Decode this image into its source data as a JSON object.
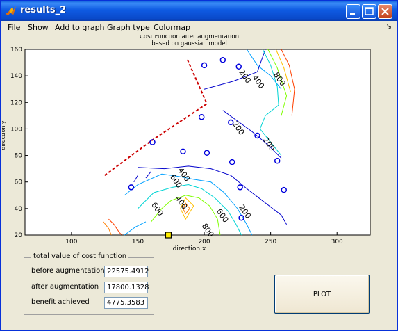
{
  "window": {
    "title": "results_2"
  },
  "menu": [
    "File",
    "Show",
    "Add to graph",
    "Graph type",
    "Colormap"
  ],
  "chart_data": {
    "type": "contour",
    "title_lines": [
      "Cost Function after augmentation",
      "based on gaussian model"
    ],
    "xlabel": "direction x",
    "ylabel": "direction y",
    "xlim": [
      65,
      325
    ],
    "ylim": [
      20,
      160
    ],
    "xticks": [
      100,
      150,
      200,
      250,
      300
    ],
    "yticks": [
      20,
      40,
      60,
      80,
      100,
      120,
      140,
      160
    ],
    "points": [
      [
        200,
        148
      ],
      [
        214,
        152
      ],
      [
        226,
        147
      ],
      [
        198,
        109
      ],
      [
        220,
        105
      ],
      [
        240,
        95
      ],
      [
        184,
        83
      ],
      [
        202,
        82
      ],
      [
        161,
        90
      ],
      [
        221,
        75
      ],
      [
        255,
        76
      ],
      [
        145,
        56
      ],
      [
        227,
        56
      ],
      [
        260,
        54
      ],
      [
        228,
        33
      ]
    ],
    "highlight_point": [
      173,
      20
    ],
    "boundary_line": [
      [
        125,
        65
      ],
      [
        160,
        91
      ],
      [
        202,
        119
      ],
      [
        187,
        153
      ]
    ],
    "contour_labels": [
      {
        "text": "200",
        "x": 226,
        "y": 143
      },
      {
        "text": "200",
        "x": 244,
        "y": 92
      },
      {
        "text": "200",
        "x": 221,
        "y": 104
      },
      {
        "text": "200",
        "x": 226,
        "y": 41
      },
      {
        "text": "400",
        "x": 236,
        "y": 139
      },
      {
        "text": "400",
        "x": 180,
        "y": 69
      },
      {
        "text": "400",
        "x": 178,
        "y": 48
      },
      {
        "text": "600",
        "x": 174,
        "y": 64
      },
      {
        "text": "600",
        "x": 209,
        "y": 38
      },
      {
        "text": "600",
        "x": 160,
        "y": 43
      },
      {
        "text": "800",
        "x": 252,
        "y": 141
      },
      {
        "text": "800",
        "x": 198,
        "y": 27
      }
    ]
  },
  "results": {
    "group_title": "total value of cost function",
    "rows": [
      {
        "label": "before augmentation",
        "value": "22575.4912"
      },
      {
        "label": "after augmentation",
        "value": "17800.1328"
      },
      {
        "label": "benefit achieved",
        "value": "4775.3583"
      }
    ]
  },
  "plot_button": "PLOT"
}
